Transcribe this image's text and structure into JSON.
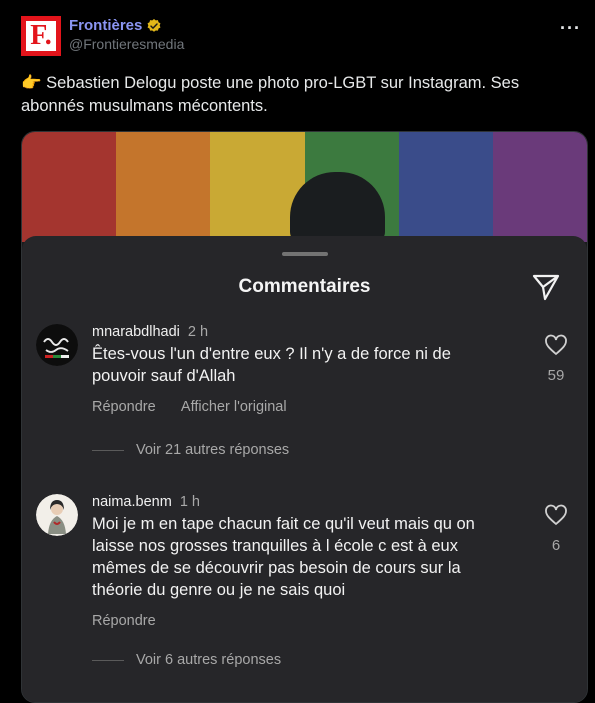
{
  "author": {
    "display_name": "Frontières",
    "handle": "@Frontieresmedia",
    "logo_letter": "F.",
    "verified_icon": "gold-verified-badge",
    "more_label": "···"
  },
  "tweet": {
    "text": "👉 Sebastien Delogu poste une photo pro-LGBT sur Instagram. Ses abonnés musulmans mécontents."
  },
  "media": {
    "sheet_title": "Commentaires",
    "rainbow_colors": [
      "#a4352f",
      "#c4752c",
      "#c9a934",
      "#3c7a3f",
      "#3a4c8a",
      "#6a3a7a"
    ],
    "comments": [
      {
        "user": "mnarabdlhadi",
        "time": "2 h",
        "text": "Êtes-vous l'un d'entre eux ? Il n'y a de force ni de pouvoir sauf d'Allah",
        "reply": "Répondre",
        "translate": "Afficher l'original",
        "likes": "59",
        "more_replies": "Voir 21 autres réponses"
      },
      {
        "user": "naima.benm",
        "time": "1 h",
        "text": "Moi je m en tape chacun fait ce qu'il veut mais qu on laisse nos grosses tranquilles à l école c est à eux mêmes de se découvrir pas besoin de cours sur la théorie du genre ou je ne sais quoi",
        "reply": "Répondre",
        "likes": "6",
        "more_replies": "Voir 6 autres réponses"
      }
    ]
  }
}
